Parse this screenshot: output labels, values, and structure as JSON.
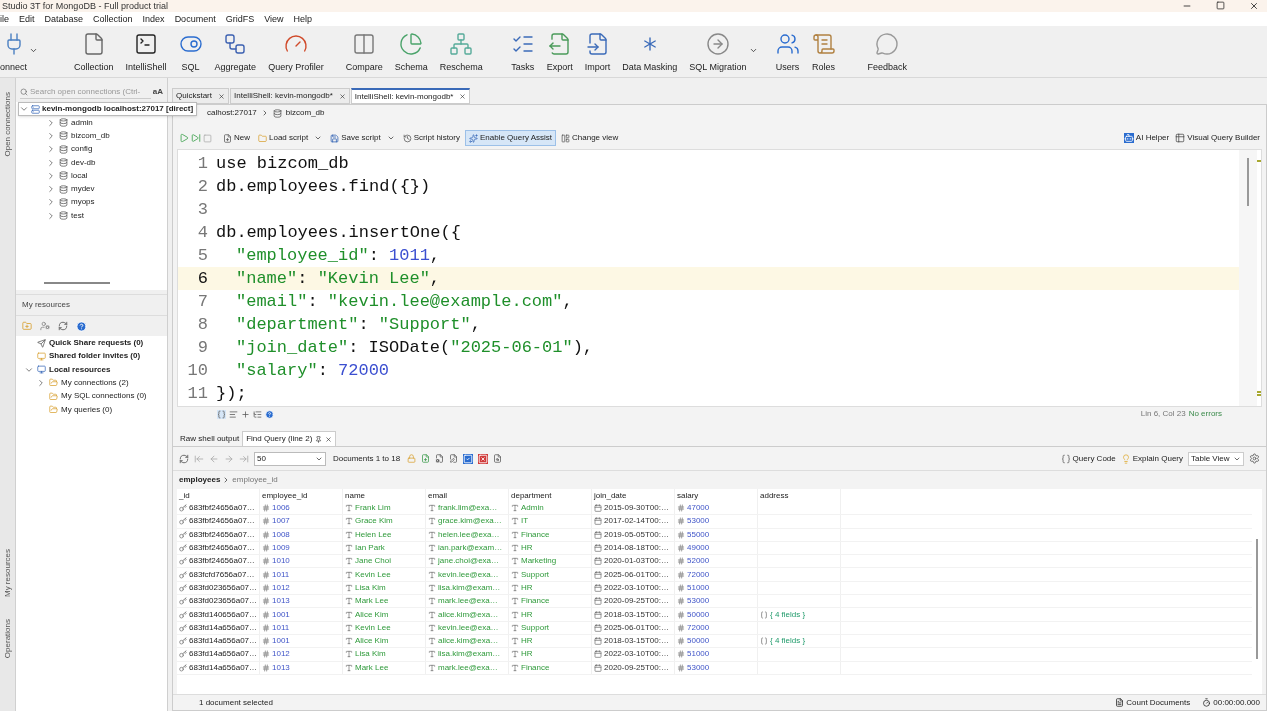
{
  "window": {
    "title": "Studio 3T for MongoDB - Full product trial"
  },
  "menu": [
    "ile",
    "Edit",
    "Database",
    "Collection",
    "Index",
    "Document",
    "GridFS",
    "View",
    "Help"
  ],
  "toolbar": [
    {
      "label": "onnect",
      "dropdown": true
    },
    {
      "label": "Collection",
      "dropdown": false
    },
    {
      "label": "IntelliShell",
      "dropdown": false
    },
    {
      "label": "SQL",
      "dropdown": false
    },
    {
      "label": "Aggregate",
      "dropdown": false
    },
    {
      "label": "Query Profiler",
      "dropdown": false
    },
    {
      "label": "Compare",
      "dropdown": false
    },
    {
      "label": "Schema",
      "dropdown": false
    },
    {
      "label": "Reschema",
      "dropdown": false
    },
    {
      "label": "Tasks",
      "dropdown": false
    },
    {
      "label": "Export",
      "dropdown": false
    },
    {
      "label": "Import",
      "dropdown": false
    },
    {
      "label": "Data Masking",
      "dropdown": false
    },
    {
      "label": "SQL Migration",
      "dropdown": true
    },
    {
      "label": "Users",
      "dropdown": false
    },
    {
      "label": "Roles",
      "dropdown": false
    },
    {
      "label": "Feedback",
      "dropdown": false
    }
  ],
  "side_tabs": [
    "Open connections",
    "My resources",
    "Operations"
  ],
  "connections": {
    "search": {
      "placeholder": "Search open connections (Ctrl-",
      "case_button": "aA"
    },
    "root": {
      "label": "kevin-mongodb localhost:27017 [direct]",
      "expanded": true,
      "children": [
        {
          "label": "admin",
          "expanded": false
        },
        {
          "label": "bizcom_db",
          "expanded": false
        },
        {
          "label": "config",
          "expanded": false
        },
        {
          "label": "dev-db",
          "expanded": false
        },
        {
          "label": "local",
          "expanded": false
        },
        {
          "label": "mydev",
          "expanded": false
        },
        {
          "label": "myops",
          "expanded": false
        },
        {
          "label": "test",
          "expanded": false
        }
      ]
    }
  },
  "resources": {
    "title": "My resources",
    "items": [
      {
        "label": "Quick Share requests (0)",
        "kind": "share"
      },
      {
        "label": "Shared folder invites (0)",
        "kind": "folder-share"
      },
      {
        "label": "Local resources",
        "kind": "local",
        "expanded": true,
        "children": [
          {
            "label": "My connections (2)",
            "expanded": false
          },
          {
            "label": "My SQL connections (0)"
          },
          {
            "label": "My queries (0)"
          }
        ]
      }
    ]
  },
  "tabs": [
    {
      "label": "Quickstart",
      "selected": false
    },
    {
      "label": "IntelliShell: kevin-mongodb*",
      "selected": false
    },
    {
      "label": "IntelliShell: kevin-mongodb*",
      "selected": true
    }
  ],
  "breadcrumb": [
    "calhost:27017",
    "bizcom_db"
  ],
  "editor_toolbar": {
    "buttons": [
      {
        "label": "New",
        "selected": false
      },
      {
        "label": "Load script",
        "selected": false
      },
      {
        "label": "Save script",
        "selected": false
      },
      {
        "label": "Script history",
        "selected": false
      },
      {
        "label": "Enable Query Assist",
        "selected": true
      },
      {
        "label": "Change view",
        "selected": false
      }
    ],
    "right": [
      "AI Helper",
      "Visual Query Builder"
    ]
  },
  "code": [
    {
      "number": "1",
      "current": false,
      "indented": false,
      "tokens": [
        {
          "text": "use bizcom_db",
          "kind": "plain"
        }
      ]
    },
    {
      "number": "2",
      "current": false,
      "indented": false,
      "tokens": [
        {
          "text": "db.employees.find({})",
          "kind": "plain"
        }
      ]
    },
    {
      "number": "3",
      "current": false
    },
    {
      "number": "4",
      "current": false,
      "indented": false,
      "tokens": [
        {
          "text": "db.employees.insertOne({",
          "kind": "plain"
        }
      ]
    },
    {
      "number": "5",
      "current": false,
      "indented": true,
      "tokens": [
        {
          "text": "\"employee_id\"",
          "kind": "key"
        },
        {
          "text": ": ",
          "kind": "plain"
        },
        {
          "text": "1011",
          "kind": "number"
        },
        {
          "text": ",",
          "kind": "plain"
        }
      ]
    },
    {
      "number": "6",
      "current": true,
      "indented": true,
      "tokens": [
        {
          "text": "\"name\"",
          "kind": "key"
        },
        {
          "text": ": ",
          "kind": "plain"
        },
        {
          "text": "\"Kevin Lee\"",
          "kind": "string"
        },
        {
          "text": ",",
          "kind": "plain"
        }
      ]
    },
    {
      "number": "7",
      "current": false,
      "indented": true,
      "tokens": [
        {
          "text": "\"email\"",
          "kind": "key"
        },
        {
          "text": ": ",
          "kind": "plain"
        },
        {
          "text": "\"kevin.lee@example.com\"",
          "kind": "string"
        },
        {
          "text": ",",
          "kind": "plain"
        }
      ]
    },
    {
      "number": "8",
      "current": false,
      "indented": true,
      "tokens": [
        {
          "text": "\"department\"",
          "kind": "key"
        },
        {
          "text": ": ",
          "kind": "plain"
        },
        {
          "text": "\"Support\"",
          "kind": "string"
        },
        {
          "text": ",",
          "kind": "plain"
        }
      ]
    },
    {
      "number": "9",
      "current": false,
      "indented": true,
      "tokens": [
        {
          "text": "\"join_date\"",
          "kind": "key"
        },
        {
          "text": ": ISODate(",
          "kind": "plain"
        },
        {
          "text": "\"2025-06-01\"",
          "kind": "string"
        },
        {
          "text": "),",
          "kind": "plain"
        }
      ]
    },
    {
      "number": "10",
      "current": false,
      "indented": true,
      "tokens": [
        {
          "text": "\"salary\"",
          "kind": "key"
        },
        {
          "text": ": ",
          "kind": "plain"
        },
        {
          "text": "72000",
          "kind": "number"
        }
      ]
    },
    {
      "number": "11",
      "current": false,
      "indented": false,
      "tokens": [
        {
          "text": "});",
          "kind": "plain"
        }
      ]
    }
  ],
  "editor_status": {
    "position": "Lin 6, Col 23",
    "errors": "No errors"
  },
  "result_tabs": [
    {
      "label": "Raw shell output",
      "selected": false
    },
    {
      "label": "Find Query (line 2)",
      "selected": true
    }
  ],
  "result_toolbar": {
    "page_size": "50",
    "documents": "Documents 1 to 18",
    "query_code": "Query Code",
    "explain": "Explain Query",
    "view": "Table View"
  },
  "result_path": [
    "employees",
    "employee_id"
  ],
  "table": {
    "columns": [
      {
        "label": "_id",
        "kind": "id"
      },
      {
        "label": "employee_id",
        "kind": "int"
      },
      {
        "label": "name",
        "kind": "string"
      },
      {
        "label": "email",
        "kind": "string"
      },
      {
        "label": "department",
        "kind": "string"
      },
      {
        "label": "join_date",
        "kind": "date"
      },
      {
        "label": "salary",
        "kind": "int"
      },
      {
        "label": "address",
        "kind": "object"
      }
    ],
    "rows": [
      {
        "cells": [
          "683fbf24656a07…",
          "1006",
          "Frank Lim",
          "frank.lim@exa…",
          "Admin",
          "2015-09-30T00:…",
          "47000"
        ]
      },
      {
        "cells": [
          "683fbf24656a07…",
          "1007",
          "Grace Kim",
          "grace.kim@exa…",
          "IT",
          "2017-02-14T00:…",
          "53000"
        ]
      },
      {
        "cells": [
          "683fbf24656a07…",
          "1008",
          "Helen Lee",
          "helen.lee@exa…",
          "Finance",
          "2019-05-05T00:…",
          "55000"
        ]
      },
      {
        "cells": [
          "683fbf24656a07…",
          "1009",
          "Ian Park",
          "ian.park@exam…",
          "HR",
          "2014-08-18T00:…",
          "49000"
        ]
      },
      {
        "cells": [
          "683fbf24656a07…",
          "1010",
          "Jane Choi",
          "jane.choi@exa…",
          "Marketing",
          "2020-01-03T00:…",
          "52000"
        ]
      },
      {
        "cells": [
          "683fcfd7656a07…",
          "1011",
          "Kevin Lee",
          "kevin.lee@exa…",
          "Support",
          "2025-06-01T00:…",
          "72000"
        ]
      },
      {
        "cells": [
          "683fd023656a07…",
          "1012",
          "Lisa Kim",
          "lisa.kim@exam…",
          "HR",
          "2022-03-10T00:…",
          "51000"
        ]
      },
      {
        "cells": [
          "683fd023656a07…",
          "1013",
          "Mark Lee",
          "mark.lee@exa…",
          "Finance",
          "2020-09-25T00:…",
          "53000"
        ]
      },
      {
        "cells": [
          "683fd140656a07…",
          "1001",
          "Alice Kim",
          "alice.kim@exa…",
          "HR",
          "2018-03-15T00:…",
          "50000",
          "{ 4 fields }"
        ]
      },
      {
        "cells": [
          "683fd14a656a07…",
          "1011",
          "Kevin Lee",
          "kevin.lee@exa…",
          "Support",
          "2025-06-01T00:…",
          "72000"
        ]
      },
      {
        "cells": [
          "683fd14a656a07…",
          "1001",
          "Alice Kim",
          "alice.kim@exa…",
          "HR",
          "2018-03-15T00:…",
          "50000",
          "{ 4 fields }"
        ]
      },
      {
        "cells": [
          "683fd14a656a07…",
          "1012",
          "Lisa Kim",
          "lisa.kim@exam…",
          "HR",
          "2022-03-10T00:…",
          "51000"
        ]
      },
      {
        "cells": [
          "683fd14a656a07…",
          "1013",
          "Mark Lee",
          "mark.lee@exa…",
          "Finance",
          "2020-09-25T00:…",
          "53000"
        ]
      }
    ]
  },
  "status_bar": {
    "selection": "1 document selected",
    "count": "Count Documents",
    "time": "00:00:00.000"
  }
}
